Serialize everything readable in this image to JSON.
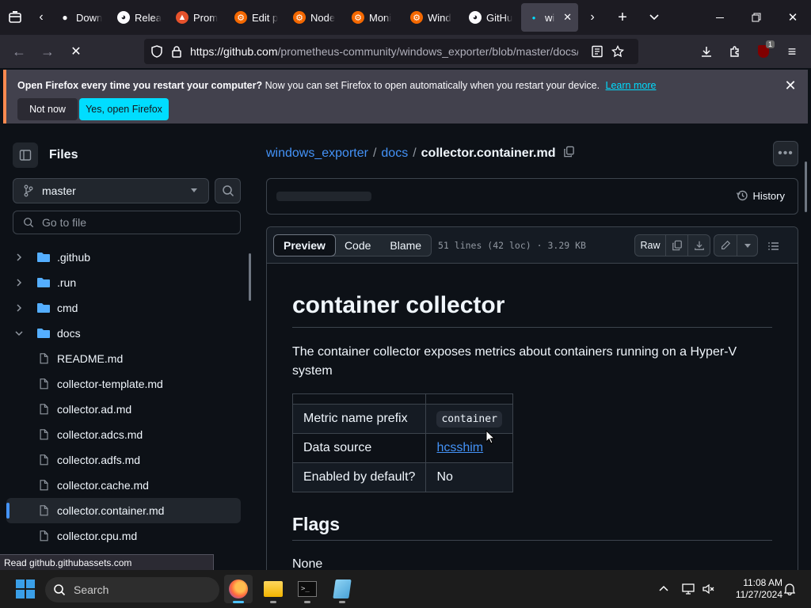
{
  "browser": {
    "tabs": [
      {
        "label": "Down",
        "favicon": "download"
      },
      {
        "label": "Relea",
        "favicon": "github"
      },
      {
        "label": "Prom",
        "favicon": "prometheus"
      },
      {
        "label": "Edit p",
        "favicon": "grafana"
      },
      {
        "label": "Node",
        "favicon": "grafana"
      },
      {
        "label": "Moni",
        "favicon": "grafana"
      },
      {
        "label": "Wind",
        "favicon": "grafana"
      },
      {
        "label": "GitHu",
        "favicon": "github"
      },
      {
        "label": "wi",
        "favicon": "loading",
        "active": true
      }
    ],
    "url_host": "https://github.com",
    "url_path": "/prometheus-community/windows_exporter/blob/master/docs/",
    "extension_badge": "1",
    "status_link": "Read github.githubassets.com"
  },
  "notification": {
    "title": "Open Firefox every time you restart your computer?",
    "message": "Now you can set Firefox to open automatically when you restart your device.",
    "learn_more": "Learn more",
    "not_now": "Not now",
    "yes": "Yes, open Firefox"
  },
  "sidebar": {
    "title": "Files",
    "branch": "master",
    "goto_placeholder": "Go to file",
    "tree": [
      {
        "name": ".github",
        "type": "folder",
        "expanded": false
      },
      {
        "name": ".run",
        "type": "folder",
        "expanded": false
      },
      {
        "name": "cmd",
        "type": "folder",
        "expanded": false
      },
      {
        "name": "docs",
        "type": "folder",
        "expanded": true
      },
      {
        "name": "README.md",
        "type": "file"
      },
      {
        "name": "collector-template.md",
        "type": "file"
      },
      {
        "name": "collector.ad.md",
        "type": "file"
      },
      {
        "name": "collector.adcs.md",
        "type": "file"
      },
      {
        "name": "collector.adfs.md",
        "type": "file"
      },
      {
        "name": "collector.cache.md",
        "type": "file"
      },
      {
        "name": "collector.container.md",
        "type": "file",
        "selected": true
      },
      {
        "name": "collector.cpu.md",
        "type": "file"
      }
    ]
  },
  "breadcrumb": {
    "repo": "windows_exporter",
    "folder": "docs",
    "file": "collector.container.md",
    "sep": "/"
  },
  "file_header": {
    "history": "History",
    "tabs": {
      "preview": "Preview",
      "code": "Code",
      "blame": "Blame"
    },
    "info": "51 lines (42 loc) · 3.29 KB",
    "raw": "Raw"
  },
  "markdown": {
    "h1": "container collector",
    "intro": "The container collector exposes metrics about containers running on a Hyper-V system",
    "table": {
      "rows": [
        {
          "key": "Metric name prefix",
          "value": "container",
          "kind": "code"
        },
        {
          "key": "Data source",
          "value": "hcsshim",
          "kind": "link"
        },
        {
          "key": "Enabled by default?",
          "value": "No",
          "kind": "text"
        }
      ]
    },
    "h2": "Flags",
    "flags_text": "None"
  },
  "taskbar": {
    "search_placeholder": "Search",
    "apps": [
      "firefox",
      "file-explorer",
      "terminal",
      "notepad"
    ],
    "time": "11:08 AM",
    "date": "11/27/2024"
  },
  "colors": {
    "accent_link": "#4493f8",
    "firefox_cta": "#00ddff",
    "notification_accent": "#ff8a50"
  }
}
